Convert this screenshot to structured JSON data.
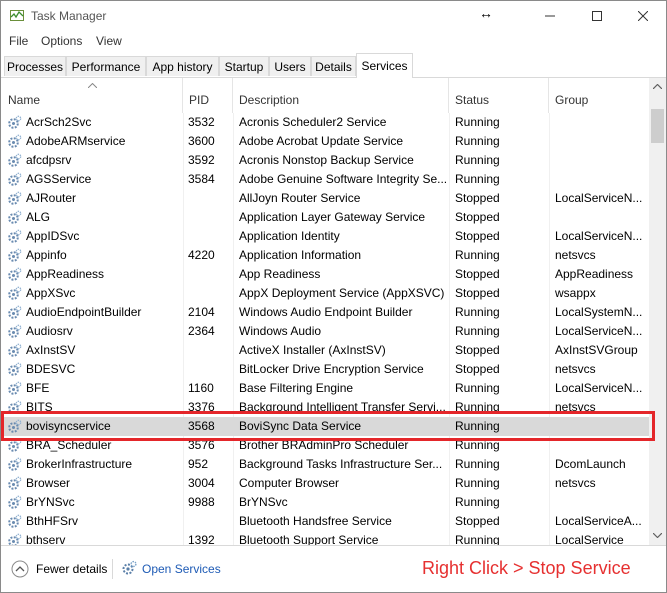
{
  "window": {
    "title": "Task Manager",
    "cursor_glyph": "↔"
  },
  "menu": [
    "File",
    "Options",
    "View"
  ],
  "tabs": [
    {
      "label": "Processes",
      "active": false
    },
    {
      "label": "Performance",
      "active": false
    },
    {
      "label": "App history",
      "active": false
    },
    {
      "label": "Startup",
      "active": false
    },
    {
      "label": "Users",
      "active": false
    },
    {
      "label": "Details",
      "active": false
    },
    {
      "label": "Services",
      "active": true
    }
  ],
  "columns": [
    "Name",
    "PID",
    "Description",
    "Status",
    "Group"
  ],
  "rows": [
    {
      "name": "AcrSch2Svc",
      "pid": "3532",
      "description": "Acronis Scheduler2 Service",
      "status": "Running",
      "group": ""
    },
    {
      "name": "AdobeARMservice",
      "pid": "3600",
      "description": "Adobe Acrobat Update Service",
      "status": "Running",
      "group": ""
    },
    {
      "name": "afcdpsrv",
      "pid": "3592",
      "description": "Acronis Nonstop Backup Service",
      "status": "Running",
      "group": ""
    },
    {
      "name": "AGSService",
      "pid": "3584",
      "description": "Adobe Genuine Software Integrity Se...",
      "status": "Running",
      "group": ""
    },
    {
      "name": "AJRouter",
      "pid": "",
      "description": "AllJoyn Router Service",
      "status": "Stopped",
      "group": "LocalServiceN..."
    },
    {
      "name": "ALG",
      "pid": "",
      "description": "Application Layer Gateway Service",
      "status": "Stopped",
      "group": ""
    },
    {
      "name": "AppIDSvc",
      "pid": "",
      "description": "Application Identity",
      "status": "Stopped",
      "group": "LocalServiceN..."
    },
    {
      "name": "Appinfo",
      "pid": "4220",
      "description": "Application Information",
      "status": "Running",
      "group": "netsvcs"
    },
    {
      "name": "AppReadiness",
      "pid": "",
      "description": "App Readiness",
      "status": "Stopped",
      "group": "AppReadiness"
    },
    {
      "name": "AppXSvc",
      "pid": "",
      "description": "AppX Deployment Service (AppXSVC)",
      "status": "Stopped",
      "group": "wsappx"
    },
    {
      "name": "AudioEndpointBuilder",
      "pid": "2104",
      "description": "Windows Audio Endpoint Builder",
      "status": "Running",
      "group": "LocalSystemN..."
    },
    {
      "name": "Audiosrv",
      "pid": "2364",
      "description": "Windows Audio",
      "status": "Running",
      "group": "LocalServiceN..."
    },
    {
      "name": "AxInstSV",
      "pid": "",
      "description": "ActiveX Installer (AxInstSV)",
      "status": "Stopped",
      "group": "AxInstSVGroup"
    },
    {
      "name": "BDESVC",
      "pid": "",
      "description": "BitLocker Drive Encryption Service",
      "status": "Stopped",
      "group": "netsvcs"
    },
    {
      "name": "BFE",
      "pid": "1160",
      "description": "Base Filtering Engine",
      "status": "Running",
      "group": "LocalServiceN..."
    },
    {
      "name": "BITS",
      "pid": "3376",
      "description": "Background Intelligent Transfer Servi...",
      "status": "Running",
      "group": "netsvcs"
    },
    {
      "name": "bovisyncservice",
      "pid": "3568",
      "description": "BoviSync Data Service",
      "status": "Running",
      "group": "",
      "selected": true
    },
    {
      "name": "BRA_Scheduler",
      "pid": "3576",
      "description": "Brother BRAdminPro Scheduler",
      "status": "Running",
      "group": ""
    },
    {
      "name": "BrokerInfrastructure",
      "pid": "952",
      "description": "Background Tasks Infrastructure Ser...",
      "status": "Running",
      "group": "DcomLaunch"
    },
    {
      "name": "Browser",
      "pid": "3004",
      "description": "Computer Browser",
      "status": "Running",
      "group": "netsvcs"
    },
    {
      "name": "BrYNSvc",
      "pid": "9988",
      "description": "BrYNSvc",
      "status": "Running",
      "group": ""
    },
    {
      "name": "BthHFSrv",
      "pid": "",
      "description": "Bluetooth Handsfree Service",
      "status": "Stopped",
      "group": "LocalServiceA..."
    },
    {
      "name": "bthserv",
      "pid": "1392",
      "description": "Bluetooth Support Service",
      "status": "Running",
      "group": "LocalService"
    }
  ],
  "footer": {
    "fewer_details": "Fewer details",
    "open_services": "Open Services",
    "hint": "Right Click > Stop Service"
  },
  "colors": {
    "highlight": "#e4262a",
    "link": "#1e5bb5",
    "selected_row": "#d9d9d9"
  }
}
